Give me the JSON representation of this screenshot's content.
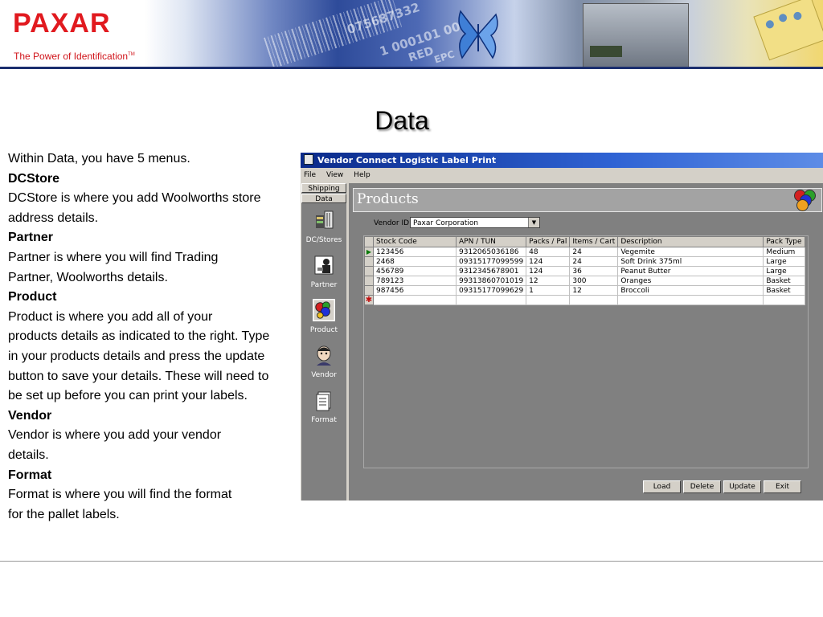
{
  "banner": {
    "logo": "PAXAR",
    "tagline": "The Power of Identification",
    "tagline_tm": "TM",
    "decor_numbers": [
      "075687332",
      "1 000101 001",
      "RED",
      "EPC"
    ]
  },
  "page": {
    "title": "Data"
  },
  "text": {
    "intro": "Within Data, you have 5 menus.",
    "sections": [
      {
        "heading": "DCStore",
        "line1": "DCStore is where you add Woolworths store",
        "line2": "address details."
      },
      {
        "heading": "Partner",
        "line1": "Partner is where you will find Trading",
        "line2": "Partner, Woolworths details."
      },
      {
        "heading": "Product",
        "line1": "Product is where you add all of your",
        "line2": "products details as indicated to the right. Type",
        "line3": "in your products details and press the update",
        "line4": "button to save your details. These will need to",
        "line5": "be set up before you can print your labels."
      },
      {
        "heading": "Vendor",
        "line1": "Vendor is where you add your vendor",
        "line2": "details."
      },
      {
        "heading": "Format",
        "line1": "Format is where you will find the format",
        "line2": "for the pallet labels."
      }
    ]
  },
  "app": {
    "title": "Vendor Connect Logistic Label Print",
    "menu": [
      "File",
      "View",
      "Help"
    ],
    "tabs": [
      "Shipping",
      "Data"
    ],
    "nav": [
      {
        "label": "DC/Stores",
        "icon": "store-shelves-icon"
      },
      {
        "label": "Partner",
        "icon": "partner-person-icon"
      },
      {
        "label": "Product",
        "icon": "product-balls-icon"
      },
      {
        "label": "Vendor",
        "icon": "vendor-face-icon"
      },
      {
        "label": "Format",
        "icon": "format-document-icon"
      }
    ],
    "selected_nav": "Product",
    "panel_title": "Products",
    "vendor_label": "Vendor ID",
    "vendor_value": "Paxar Corporation",
    "columns": [
      "Stock Code",
      "APN / TUN",
      "Packs / Pal",
      "Items / Cart",
      "Description",
      "Pack Type"
    ],
    "rows": [
      [
        "123456",
        "9312065036186",
        "48",
        "24",
        "Vegemite",
        "Medium"
      ],
      [
        "2468",
        "09315177099599",
        "124",
        "24",
        "Soft Drink 375ml",
        "Large"
      ],
      [
        "456789",
        "9312345678901",
        "124",
        "36",
        "Peanut Butter",
        "Large"
      ],
      [
        "789123",
        "99313860701019",
        "12",
        "300",
        "Oranges",
        "Basket"
      ],
      [
        "987456",
        "09315177099629",
        "1",
        "12",
        "Broccoli",
        "Basket"
      ]
    ],
    "buttons": [
      "Load",
      "Delete",
      "Update",
      "Exit"
    ]
  }
}
